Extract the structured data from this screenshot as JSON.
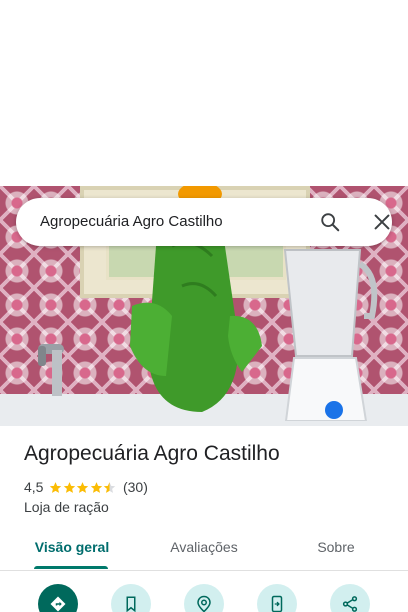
{
  "search": {
    "query": "Agropecuária Agro Castilho"
  },
  "place": {
    "name": "Agropecuária Agro Castilho",
    "rating": "4,5",
    "stars": 4.5,
    "reviews_count": "(30)",
    "category": "Loja de ração"
  },
  "tabs": [
    {
      "label": "Visão geral",
      "selected": true
    },
    {
      "label": "Avaliações",
      "selected": false
    },
    {
      "label": "Sobre",
      "selected": false
    }
  ],
  "actions": [
    {
      "icon": "directions-icon"
    },
    {
      "icon": "bookmark-icon"
    },
    {
      "icon": "nearby-icon"
    },
    {
      "icon": "send-to-phone-icon"
    },
    {
      "icon": "share-icon"
    }
  ],
  "colors": {
    "accent": "#006d6d",
    "star": "#fbbc04",
    "action_bg": "#d2efef",
    "primary_action_bg": "#00695c"
  }
}
